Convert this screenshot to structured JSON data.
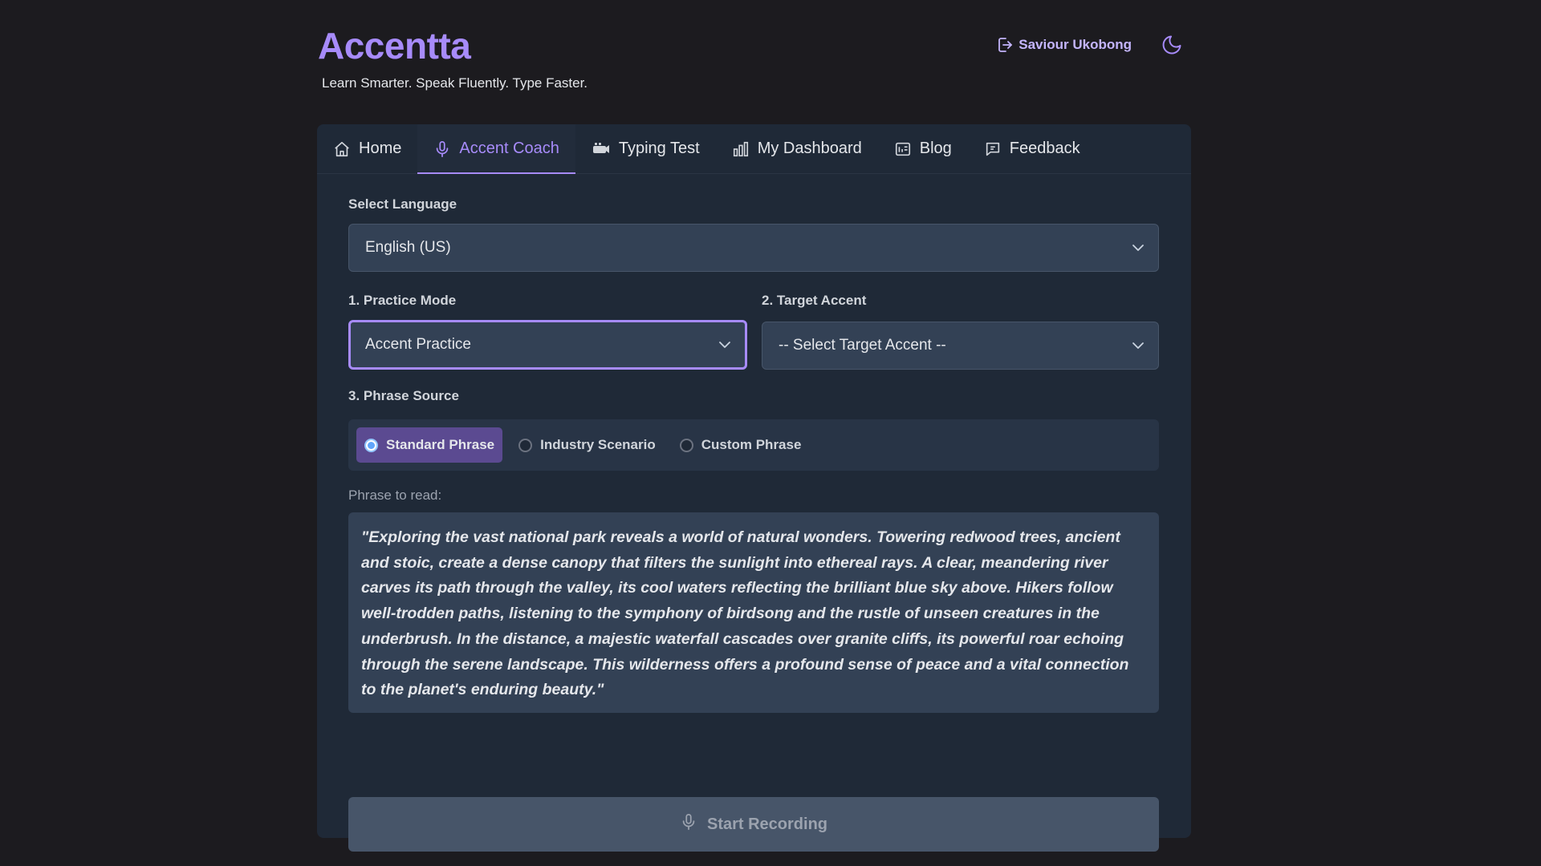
{
  "app": {
    "title": "Accentta",
    "tagline": "Learn Smarter. Speak Fluently. Type Faster.",
    "user_name": "Saviour Ukobong",
    "accent_color": "#a78bfa"
  },
  "tabs": [
    {
      "label": "Home",
      "icon": "home-icon",
      "active": false
    },
    {
      "label": "Accent Coach",
      "icon": "microphone-icon",
      "active": true
    },
    {
      "label": "Typing Test",
      "icon": "keyboard-icon",
      "active": false
    },
    {
      "label": "My Dashboard",
      "icon": "bar-chart-icon",
      "active": false
    },
    {
      "label": "Blog",
      "icon": "blog-icon",
      "active": false
    },
    {
      "label": "Feedback",
      "icon": "feedback-icon",
      "active": false
    }
  ],
  "form": {
    "language_label": "Select Language",
    "language_value": "English (US)",
    "mode_label": "1. Practice Mode",
    "mode_value": "Accent Practice",
    "accent_label": "2. Target Accent",
    "accent_value": "-- Select Target Accent --",
    "source_label": "3. Phrase Source",
    "sources": [
      {
        "label": "Standard Phrase",
        "checked": true
      },
      {
        "label": "Industry Scenario",
        "checked": false
      },
      {
        "label": "Custom Phrase",
        "checked": false
      }
    ],
    "phrase_label": "Phrase to read:",
    "phrase_text": "\"Exploring the vast national park reveals a world of natural wonders. Towering redwood trees, ancient and stoic, create a dense canopy that filters the sunlight into ethereal rays. A clear, meandering river carves its path through the valley, its cool waters reflecting the brilliant blue sky above. Hikers follow well-trodden paths, listening to the symphony of birdsong and the rustle of unseen creatures in the underbrush. In the distance, a majestic waterfall cascades over granite cliffs, its powerful roar echoing through the serene landscape. This wilderness offers a profound sense of peace and a vital connection to the planet's enduring beauty.\"",
    "record_label": "Start Recording"
  }
}
